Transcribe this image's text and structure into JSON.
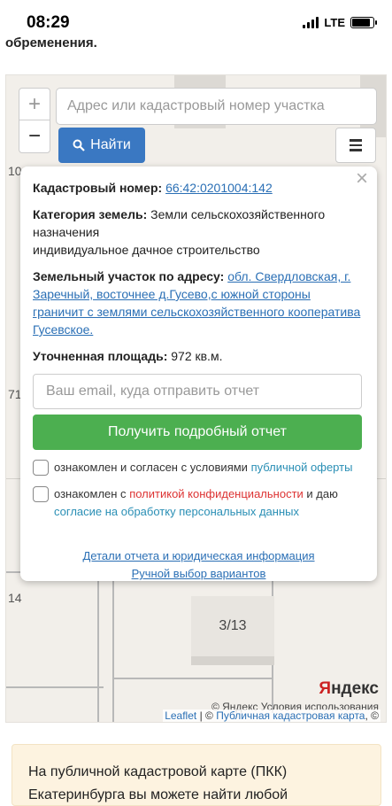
{
  "status": {
    "time": "08:29",
    "network": "LTE"
  },
  "page_top_text": "обременения.",
  "map": {
    "zoom_in": "+",
    "zoom_out": "−",
    "search_placeholder": "Адрес или кадастровый номер участка",
    "find_label": "Найти",
    "labels": [
      "10",
      "71",
      "14"
    ],
    "pager": "3/13",
    "yandex_logo_red": "Я",
    "yandex_logo_rest": "ндекс",
    "copyright": "© Яндекс  Условия использования",
    "attribution_leaflet": "Leaflet",
    "attribution_sep": " | © ",
    "attribution_pkk": "Публичная кадастровая карта",
    "attribution_tail": ", ©"
  },
  "popup": {
    "close": "×",
    "cadastral_label": "Кадастровый номер:",
    "cadastral_value": "66:42:0201004:142",
    "category_label": "Категория земель:",
    "category_value": "Земли сельскохозяйственного назначения",
    "usage_value": "индивидуальное дачное строительство",
    "address_label": "Земельный участок по адресу:",
    "address_value": "обл. Свердловская, г. Заречный, восточнее д.Гусево,с южной стороны граничит с землями сельскохозяйственного кооператива Гусевское.",
    "area_label": "Уточненная площадь:",
    "area_value": "972 кв.м.",
    "email_placeholder": "Ваш email, куда отправить отчет",
    "get_report": "Получить подробный отчет",
    "consent1_text": "ознакомлен и согласен с условиями ",
    "consent1_link": "публичной оферты",
    "consent2_text_a": "ознакомлен с ",
    "consent2_link": "политикой конфиденциальности",
    "consent2_text_b": " и даю ",
    "consent2_link2": "согласие на обработку персональных данных",
    "details_link": "Детали отчета и юридическая информация",
    "manual_link": "Ручной выбор вариантов"
  },
  "info_box": {
    "line1": "На публичной кадастровой карте (ПКК)",
    "line2": "Екатеринбурга вы можете найти любой"
  }
}
